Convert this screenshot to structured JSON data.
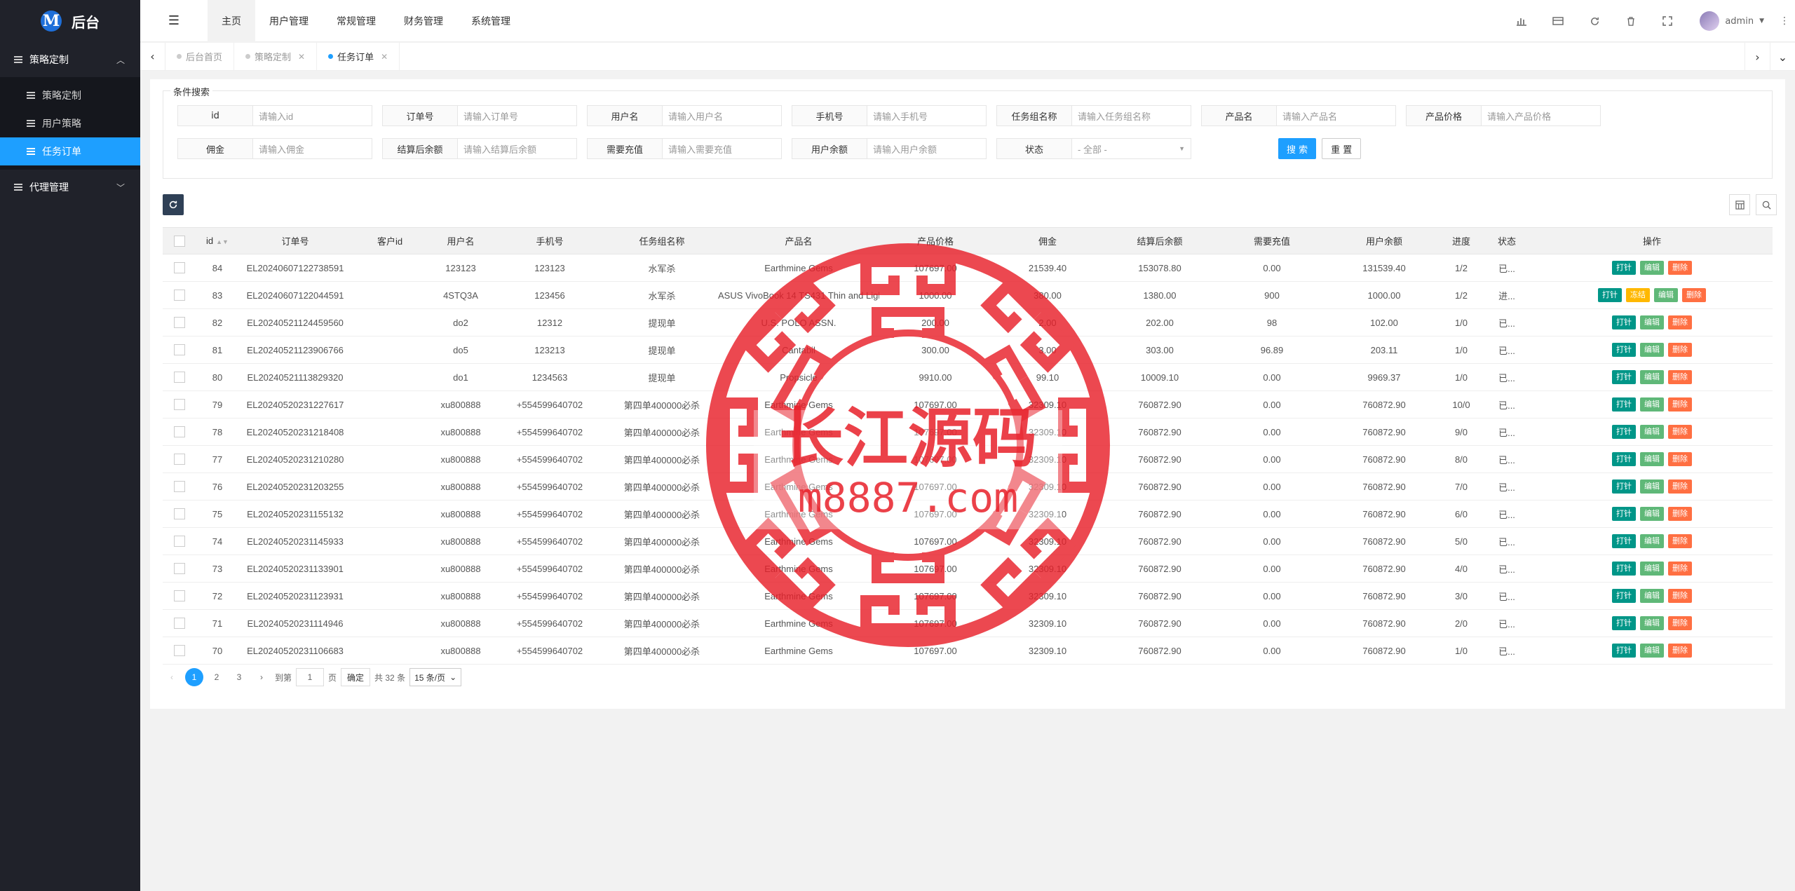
{
  "app": {
    "logo_letter": "M",
    "logo_text": "后台"
  },
  "sidebar": {
    "groups": [
      {
        "label": "策略定制",
        "chevron": "︿",
        "items": [
          "策略定制",
          "用户策略",
          "任务订单"
        ],
        "active_item": "任务订单"
      },
      {
        "label": "代理管理",
        "chevron": "﹀"
      }
    ]
  },
  "header": {
    "menu": [
      "主页",
      "用户管理",
      "常规管理",
      "财务管理",
      "系统管理"
    ],
    "active_menu": "主页",
    "user": "admin"
  },
  "tabs": [
    {
      "label": "后台首页",
      "closable": false,
      "active": false
    },
    {
      "label": "策略定制",
      "closable": true,
      "active": false
    },
    {
      "label": "任务订单",
      "closable": true,
      "active": true
    }
  ],
  "search": {
    "legend": "条件搜索",
    "fields_row1": [
      {
        "label": "id",
        "placeholder": "请输入id"
      },
      {
        "label": "订单号",
        "placeholder": "请输入订单号"
      },
      {
        "label": "用户名",
        "placeholder": "请输入用户名"
      },
      {
        "label": "手机号",
        "placeholder": "请输入手机号"
      },
      {
        "label": "任务组名称",
        "placeholder": "请输入任务组名称"
      },
      {
        "label": "产品名",
        "placeholder": "请输入产品名"
      },
      {
        "label": "产品价格",
        "placeholder": "请输入产品价格"
      }
    ],
    "fields_row2": [
      {
        "label": "佣金",
        "placeholder": "请输入佣金"
      },
      {
        "label": "结算后余额",
        "placeholder": "请输入结算后余额"
      },
      {
        "label": "需要充值",
        "placeholder": "请输入需要充值"
      },
      {
        "label": "用户余额",
        "placeholder": "请输入用户余额"
      }
    ],
    "status_label": "状态",
    "status_value": "- 全部 -",
    "search_btn": "搜 索",
    "reset_btn": "重 置"
  },
  "table": {
    "headers": [
      "id",
      "订单号",
      "客户id",
      "用户名",
      "手机号",
      "任务组名称",
      "产品名",
      "产品价格",
      "佣金",
      "结算后余额",
      "需要充值",
      "用户余额",
      "进度",
      "状态",
      "操作"
    ],
    "op_labels": {
      "print": "打针",
      "freeze": "冻结",
      "edit": "编辑",
      "delete": "删除"
    },
    "rows": [
      [
        "84",
        "EL20240607122738591",
        "",
        "123123",
        "123123",
        "水军杀",
        "Earthmine Gems",
        "107697.00",
        "21539.40",
        "153078.80",
        "0.00",
        "131539.40",
        "1/2",
        "已..."
      ],
      [
        "83",
        "EL20240607122044591",
        "",
        "4STQ3A",
        "123456",
        "水军杀",
        "ASUS VivoBook 14 TS431 Thin and Light",
        "1000.00",
        "380.00",
        "1380.00",
        "900",
        "1000.00",
        "1/2",
        "进..."
      ],
      [
        "82",
        "EL20240521124459560",
        "",
        "do2",
        "12312",
        "提现单",
        "U.S. POLO ASSN.",
        "200.00",
        "2.00",
        "202.00",
        "98",
        "102.00",
        "1/0",
        "已..."
      ],
      [
        "81",
        "EL20240521123906766",
        "",
        "do5",
        "123213",
        "提现单",
        "Cantabil",
        "300.00",
        "3.00",
        "303.00",
        "96.89",
        "203.11",
        "1/0",
        "已..."
      ],
      [
        "80",
        "EL20240521113829320",
        "",
        "do1",
        "1234563",
        "提现单",
        "Propsicle",
        "9910.00",
        "99.10",
        "10009.10",
        "0.00",
        "9969.37",
        "1/0",
        "已..."
      ],
      [
        "79",
        "EL20240520231227617",
        "",
        "xu800888",
        "+554599640702",
        "第四单400000必杀",
        "Earthmine Gems",
        "107697.00",
        "32309.10",
        "760872.90",
        "0.00",
        "760872.90",
        "10/0",
        "已..."
      ],
      [
        "78",
        "EL20240520231218408",
        "",
        "xu800888",
        "+554599640702",
        "第四单400000必杀",
        "Earthmine Gems",
        "107697.00",
        "32309.10",
        "760872.90",
        "0.00",
        "760872.90",
        "9/0",
        "已..."
      ],
      [
        "77",
        "EL20240520231210280",
        "",
        "xu800888",
        "+554599640702",
        "第四单400000必杀",
        "Earthmine Gems",
        "107697.00",
        "32309.10",
        "760872.90",
        "0.00",
        "760872.90",
        "8/0",
        "已..."
      ],
      [
        "76",
        "EL20240520231203255",
        "",
        "xu800888",
        "+554599640702",
        "第四单400000必杀",
        "Earthmine Gems",
        "107697.00",
        "32309.10",
        "760872.90",
        "0.00",
        "760872.90",
        "7/0",
        "已..."
      ],
      [
        "75",
        "EL20240520231155132",
        "",
        "xu800888",
        "+554599640702",
        "第四单400000必杀",
        "Earthmine Gems",
        "107697.00",
        "32309.10",
        "760872.90",
        "0.00",
        "760872.90",
        "6/0",
        "已..."
      ],
      [
        "74",
        "EL20240520231145933",
        "",
        "xu800888",
        "+554599640702",
        "第四单400000必杀",
        "Earthmine Gems",
        "107697.00",
        "32309.10",
        "760872.90",
        "0.00",
        "760872.90",
        "5/0",
        "已..."
      ],
      [
        "73",
        "EL20240520231133901",
        "",
        "xu800888",
        "+554599640702",
        "第四单400000必杀",
        "Earthmine Gems",
        "107697.00",
        "32309.10",
        "760872.90",
        "0.00",
        "760872.90",
        "4/0",
        "已..."
      ],
      [
        "72",
        "EL20240520231123931",
        "",
        "xu800888",
        "+554599640702",
        "第四单400000必杀",
        "Earthmine Gems",
        "107697.00",
        "32309.10",
        "760872.90",
        "0.00",
        "760872.90",
        "3/0",
        "已..."
      ],
      [
        "71",
        "EL20240520231114946",
        "",
        "xu800888",
        "+554599640702",
        "第四单400000必杀",
        "Earthmine Gems",
        "107697.00",
        "32309.10",
        "760872.90",
        "0.00",
        "760872.90",
        "2/0",
        "已..."
      ],
      [
        "70",
        "EL20240520231106683",
        "",
        "xu800888",
        "+554599640702",
        "第四单400000必杀",
        "Earthmine Gems",
        "107697.00",
        "32309.10",
        "760872.90",
        "0.00",
        "760872.90",
        "1/0",
        "已..."
      ]
    ],
    "freeze_rows": [
      "83"
    ]
  },
  "pager": {
    "prev": "‹",
    "pages": [
      "1",
      "2",
      "3"
    ],
    "current": "1",
    "next": "›",
    "goto_label": "到第",
    "goto_value": "1",
    "page_unit": "页",
    "confirm": "确定",
    "total": "共 32 条",
    "page_size": "15 条/页"
  },
  "watermark": {
    "title": "长江源码",
    "url": "m8887.com"
  },
  "colors": {
    "sidebar_bg": "#20222a",
    "accent": "#1e9fff",
    "teal": "#009688",
    "green": "#5fb878",
    "red": "#ff5722",
    "yellow": "#ffb800",
    "stamp": "#e8202a"
  },
  "icons": {
    "hamburger": "menu-fold-icon",
    "header": [
      "bar-chart-icon",
      "card-icon",
      "refresh-icon",
      "trash-icon",
      "fullscreen-icon"
    ],
    "more": "more-vertical-icon",
    "toolbar_left": "refresh-icon",
    "toolbar_right": [
      "columns-icon",
      "search-icon"
    ]
  }
}
